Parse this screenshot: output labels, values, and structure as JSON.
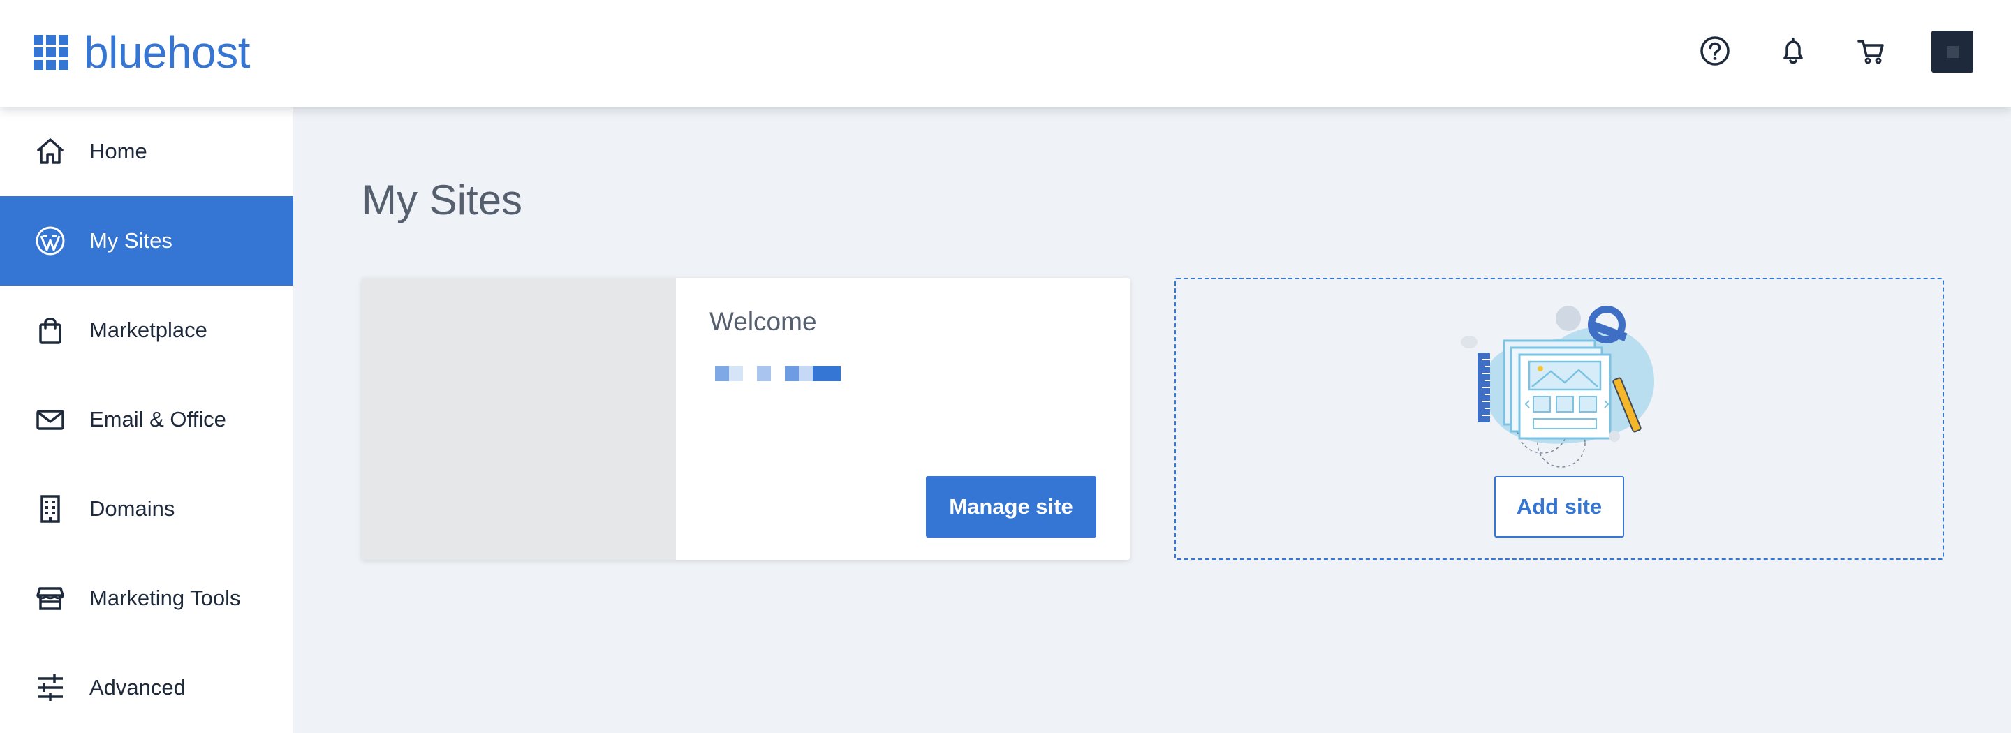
{
  "brand": {
    "name": "bluehost",
    "color": "#3575d3"
  },
  "header": {
    "icons": [
      "help-icon",
      "bell-icon",
      "cart-icon"
    ]
  },
  "sidebar": {
    "items": [
      {
        "label": "Home",
        "icon": "home-icon",
        "active": false
      },
      {
        "label": "My Sites",
        "icon": "wordpress-icon",
        "active": true
      },
      {
        "label": "Marketplace",
        "icon": "shopping-bag-icon",
        "active": false
      },
      {
        "label": "Email & Office",
        "icon": "envelope-icon",
        "active": false
      },
      {
        "label": "Domains",
        "icon": "building-icon",
        "active": false
      },
      {
        "label": "Marketing Tools",
        "icon": "storefront-icon",
        "active": false
      },
      {
        "label": "Advanced",
        "icon": "sliders-icon",
        "active": false
      }
    ]
  },
  "main": {
    "title": "My Sites",
    "site": {
      "name": "Welcome",
      "manage_label": "Manage site"
    },
    "add_site": {
      "label": "Add site"
    }
  },
  "colors": {
    "accent": "#3575d3",
    "background": "#eff2f6",
    "text": "#1e2a3b"
  }
}
